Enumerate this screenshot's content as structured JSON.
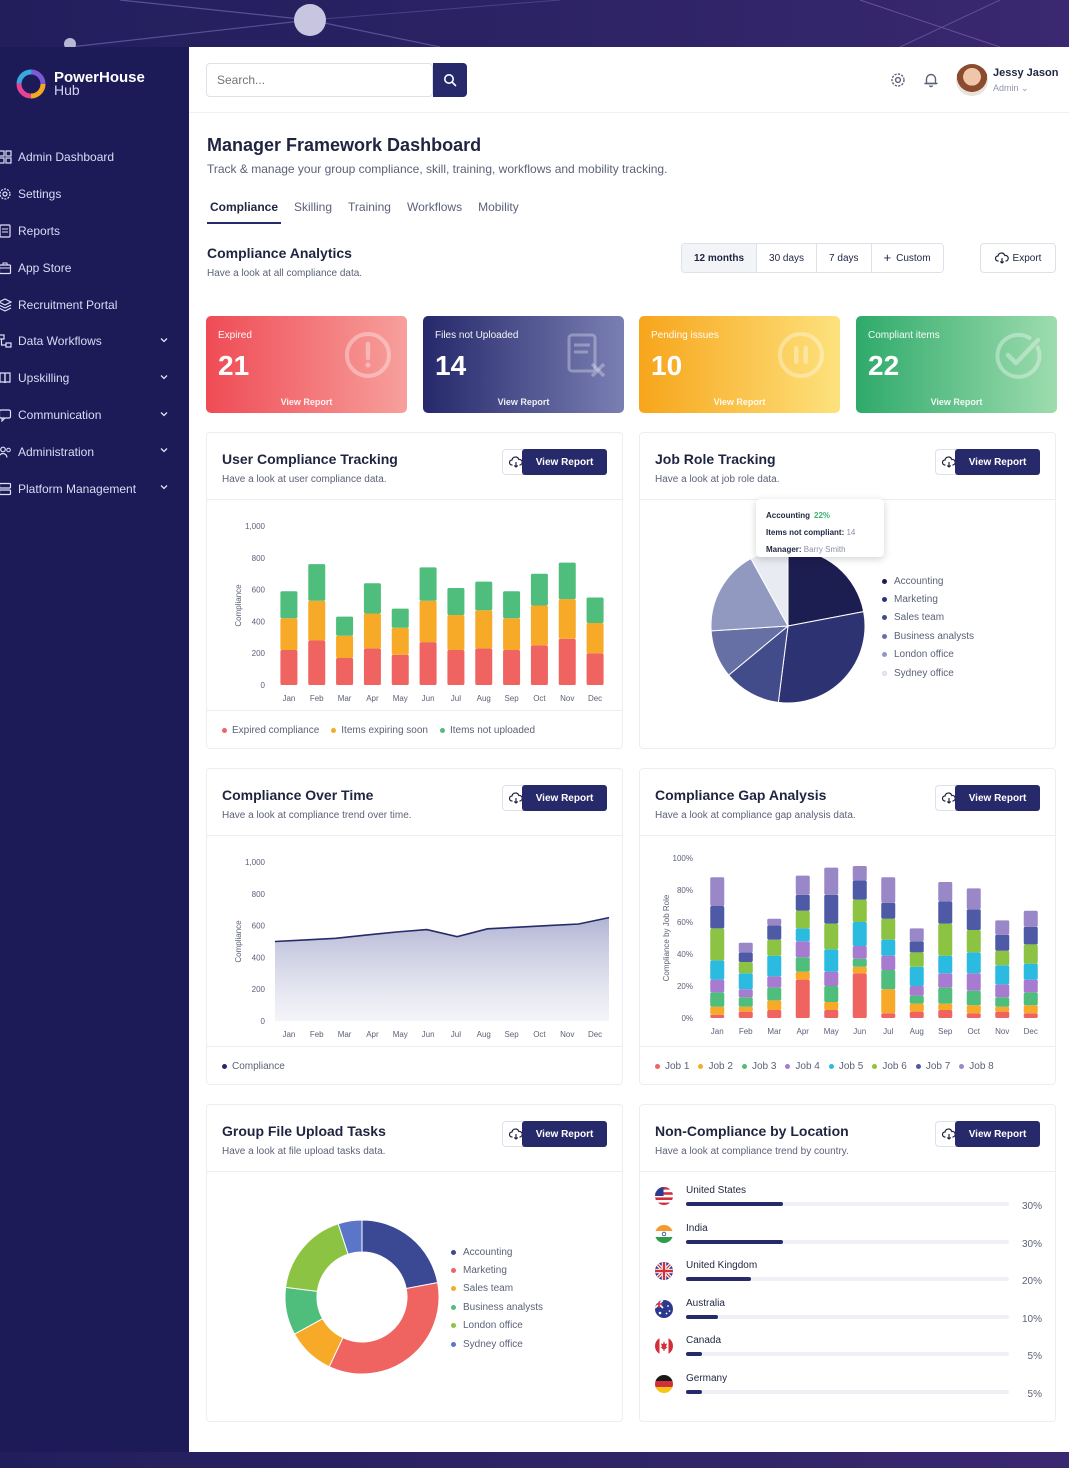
{
  "app": {
    "name_line1": "PowerHouse",
    "name_line2": "Hub"
  },
  "sidebar": {
    "items": [
      {
        "label": "Admin Dashboard",
        "icon": "grid-icon",
        "expandable": false
      },
      {
        "label": "Settings",
        "icon": "gear-icon",
        "expandable": false
      },
      {
        "label": "Reports",
        "icon": "document-icon",
        "expandable": false
      },
      {
        "label": "App Store",
        "icon": "store-icon",
        "expandable": false
      },
      {
        "label": "Recruitment Portal",
        "icon": "layers-icon",
        "expandable": false
      },
      {
        "label": "Data Workflows",
        "icon": "workflow-icon",
        "expandable": true
      },
      {
        "label": "Upskilling",
        "icon": "book-icon",
        "expandable": true
      },
      {
        "label": "Communication",
        "icon": "chat-icon",
        "expandable": true
      },
      {
        "label": "Administration",
        "icon": "users-icon",
        "expandable": true
      },
      {
        "label": "Platform Management",
        "icon": "server-icon",
        "expandable": true
      }
    ]
  },
  "topbar": {
    "search_placeholder": "Search...",
    "user_name": "Jessy Jason",
    "user_role": "Admin"
  },
  "page": {
    "title": "Manager Framework Dashboard",
    "subtitle": "Track & manage your group compliance, skill, training, workflows and mobility tracking.",
    "tabs": [
      "Compliance",
      "Skilling",
      "Training",
      "Workflows",
      "Mobility"
    ],
    "active_tab": "Compliance"
  },
  "analytics": {
    "title": "Compliance Analytics",
    "subtitle": "Have a look at all compliance data.",
    "ranges": [
      "12 months",
      "30 days",
      "7 days",
      "Custom"
    ],
    "active_range": "12 months",
    "export_label": "Export"
  },
  "kpis": [
    {
      "label": "Expired",
      "value": "21",
      "link": "View Report",
      "icon": "alert-icon",
      "from": "#ef4b55",
      "to": "#f7a09c"
    },
    {
      "label": "Files not Uploaded",
      "value": "14",
      "link": "View Report",
      "icon": "file-x-icon",
      "from": "#25286a",
      "to": "#7a7fb3"
    },
    {
      "label": "Pending issues",
      "value": "10",
      "link": "View Report",
      "icon": "pause-icon",
      "from": "#f7a51b",
      "to": "#fde27d"
    },
    {
      "label": "Compliant items",
      "value": "22",
      "link": "View Report",
      "icon": "check-icon",
      "from": "#2eaa6a",
      "to": "#9edcae"
    }
  ],
  "cards": {
    "view_report": "View Report",
    "user_compliance": {
      "title": "User Compliance Tracking",
      "subtitle": "Have a look at user compliance data."
    },
    "job_role": {
      "title": "Job Role Tracking",
      "subtitle": "Have a look at job role data."
    },
    "over_time": {
      "title": "Compliance Over Time",
      "subtitle": "Have a look at compliance trend over time."
    },
    "gap": {
      "title": "Compliance Gap Analysis",
      "subtitle": "Have a look at compliance gap analysis data."
    },
    "file_upload": {
      "title": "Group File Upload Tasks",
      "subtitle": "Have a look at file upload tasks data."
    },
    "location": {
      "title": "Non-Compliance by Location",
      "subtitle": "Have a look at compliance trend by country."
    }
  },
  "tooltip": {
    "title": "Accounting",
    "pct": "22%",
    "line2_label": "Items not compliant:",
    "line2_value": "14",
    "line3_label": "Manager:",
    "line3_value": "Barry Smith"
  },
  "locations": [
    {
      "country": "United States",
      "flag": "us-flag-icon",
      "percent": 30,
      "label": "30%"
    },
    {
      "country": "India",
      "flag": "india-flag-icon",
      "percent": 30,
      "label": "30%"
    },
    {
      "country": "United Kingdom",
      "flag": "uk-flag-icon",
      "percent": 20,
      "label": "20%"
    },
    {
      "country": "Australia",
      "flag": "australia-flag-icon",
      "percent": 10,
      "label": "10%"
    },
    {
      "country": "Canada",
      "flag": "canada-flag-icon",
      "percent": 5,
      "label": "5%"
    },
    {
      "country": "Germany",
      "flag": "germany-flag-icon",
      "percent": 5,
      "label": "5%"
    }
  ],
  "colors": {
    "navy": "#262a6b",
    "red": "#ef6461",
    "orange": "#f7a928",
    "green": "#4fbd7b",
    "area": "#c7c9e0"
  },
  "chart_data": [
    {
      "id": "user_compliance",
      "type": "bar",
      "stacked": true,
      "ylabel": "Compliance",
      "ylim": [
        0,
        1000
      ],
      "yticks": [
        "1,000",
        "800",
        "600",
        "400",
        "200",
        "0"
      ],
      "categories": [
        "Jan",
        "Feb",
        "Mar",
        "Apr",
        "May",
        "Jun",
        "Jul",
        "Aug",
        "Sep",
        "Oct",
        "Nov",
        "Dec"
      ],
      "series": [
        {
          "name": "Expired compliance",
          "color": "#ef6461",
          "values": [
            220,
            280,
            170,
            230,
            190,
            270,
            220,
            230,
            220,
            250,
            290,
            200
          ]
        },
        {
          "name": "Items expiring soon",
          "color": "#f7a928",
          "values": [
            200,
            250,
            140,
            220,
            170,
            260,
            220,
            240,
            200,
            250,
            250,
            190
          ]
        },
        {
          "name": "Items not uploaded",
          "color": "#4fbd7b",
          "values": [
            170,
            230,
            120,
            190,
            120,
            210,
            170,
            180,
            170,
            200,
            230,
            160
          ]
        }
      ],
      "legend": "bottom"
    },
    {
      "id": "job_role",
      "type": "pie",
      "labels": [
        "Accounting",
        "Marketing",
        "Sales team",
        "Business analysts",
        "London office",
        "Sydney office"
      ],
      "values": [
        22,
        30,
        12,
        10,
        18,
        8
      ],
      "colors": [
        "#1c1d50",
        "#2d3372",
        "#424c8a",
        "#6770a5",
        "#9199c1",
        "#e9ebf3"
      ],
      "legend": "right"
    },
    {
      "id": "over_time",
      "type": "area",
      "ylabel": "Compliance",
      "ylim": [
        0,
        1000
      ],
      "yticks": [
        "1,000",
        "800",
        "600",
        "400",
        "200",
        "0"
      ],
      "categories": [
        "Jan",
        "Feb",
        "Mar",
        "Apr",
        "May",
        "Jun",
        "Jul",
        "Aug",
        "Sep",
        "Oct",
        "Nov",
        "Dec"
      ],
      "series": [
        {
          "name": "Compliance",
          "values": [
            500,
            510,
            520,
            540,
            560,
            575,
            530,
            580,
            590,
            600,
            610,
            650
          ]
        }
      ],
      "legend": "bottom"
    },
    {
      "id": "gap",
      "type": "bar",
      "stacked": true,
      "ylabel": "Compliance by Job Role",
      "ylim": [
        0,
        100
      ],
      "yticks": [
        "100%",
        "80%",
        "60%",
        "40%",
        "20%",
        "0%"
      ],
      "categories": [
        "Jan",
        "Feb",
        "Mar",
        "Apr",
        "May",
        "Jun",
        "Jul",
        "Aug",
        "Sep",
        "Oct",
        "Nov",
        "Dec"
      ],
      "series": [
        {
          "name": "Job 1",
          "color": "#ef6461",
          "values": [
            2,
            4,
            5,
            24,
            5,
            28,
            3,
            4,
            5,
            3,
            4,
            3
          ]
        },
        {
          "name": "Job 2",
          "color": "#f7a928",
          "values": [
            5,
            3,
            6,
            5,
            5,
            4,
            15,
            5,
            4,
            5,
            3,
            5
          ]
        },
        {
          "name": "Job 3",
          "color": "#4fbd7b",
          "values": [
            9,
            6,
            8,
            9,
            10,
            5,
            12,
            5,
            10,
            9,
            6,
            8
          ]
        },
        {
          "name": "Job 4",
          "color": "#a67bd0",
          "values": [
            8,
            5,
            7,
            10,
            9,
            8,
            9,
            6,
            9,
            11,
            8,
            8
          ]
        },
        {
          "name": "Job 5",
          "color": "#2bbbe0",
          "values": [
            12,
            10,
            13,
            8,
            14,
            15,
            10,
            12,
            11,
            13,
            12,
            10
          ]
        },
        {
          "name": "Job 6",
          "color": "#8cc342",
          "values": [
            20,
            7,
            10,
            11,
            16,
            14,
            13,
            9,
            20,
            14,
            9,
            12
          ]
        },
        {
          "name": "Job 7",
          "color": "#4f5aa6",
          "values": [
            14,
            6,
            9,
            10,
            18,
            12,
            10,
            7,
            14,
            13,
            10,
            11
          ]
        },
        {
          "name": "Job 8",
          "color": "#9a87c7",
          "values": [
            18,
            6,
            4,
            12,
            17,
            9,
            16,
            8,
            12,
            13,
            9,
            10
          ]
        }
      ],
      "legend": "bottom"
    },
    {
      "id": "file_upload",
      "type": "pie",
      "donut": true,
      "labels": [
        "Accounting",
        "Marketing",
        "Sales team",
        "Business analysts",
        "London office",
        "Sydney office"
      ],
      "values": [
        22,
        35,
        10,
        10,
        18,
        5
      ],
      "colors": [
        "#3b4894",
        "#ef6461",
        "#f7a928",
        "#4fbd7b",
        "#8cc342",
        "#5b75c9"
      ],
      "legend": "right"
    }
  ]
}
